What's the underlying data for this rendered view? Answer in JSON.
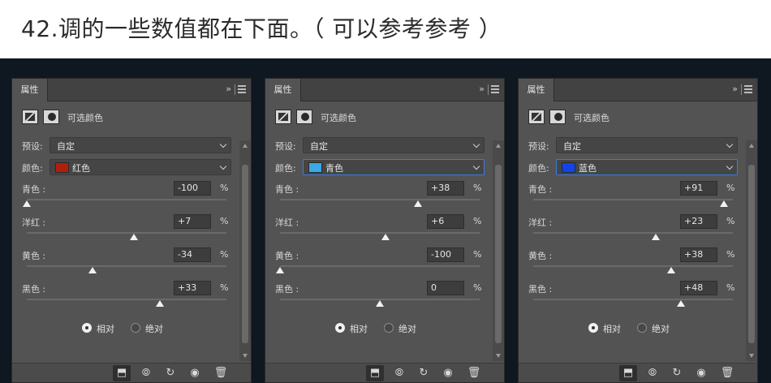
{
  "heading": "42.调的一些数值都在下面。（ 可以参考参考 ）",
  "common": {
    "tab": "属性",
    "collapse_icon": "»",
    "type_label": "可选颜色",
    "preset_label": "预设:",
    "preset_value": "自定",
    "color_label": "颜色:",
    "percent_symbol": "%",
    "radio_relative": "相对",
    "radio_absolute": "绝对"
  },
  "panels": [
    {
      "color_name": "红色",
      "swatch_color": "#b11e0c",
      "sliders": [
        {
          "label": "青色 :",
          "value": "-100",
          "percent": -100
        },
        {
          "label": "洋红 :",
          "value": "+7",
          "percent": 7
        },
        {
          "label": "黄色 :",
          "value": "-34",
          "percent": -34
        },
        {
          "label": "黑色 :",
          "value": "+33",
          "percent": 33
        }
      ]
    },
    {
      "color_name": "青色",
      "swatch_color": "#3aa9e6",
      "sliders": [
        {
          "label": "青色 :",
          "value": "+38",
          "percent": 38
        },
        {
          "label": "洋红 :",
          "value": "+6",
          "percent": 6
        },
        {
          "label": "黄色 :",
          "value": "-100",
          "percent": -100
        },
        {
          "label": "黑色 :",
          "value": "0",
          "percent": 0
        }
      ]
    },
    {
      "color_name": "蓝色",
      "swatch_color": "#1044ea",
      "sliders": [
        {
          "label": "青色 :",
          "value": "+91",
          "percent": 91
        },
        {
          "label": "洋红 :",
          "value": "+23",
          "percent": 23
        },
        {
          "label": "黄色 :",
          "value": "+38",
          "percent": 38
        },
        {
          "label": "黑色 :",
          "value": "+48",
          "percent": 48
        }
      ]
    }
  ],
  "icons": {
    "clip": "clip-to-layer-icon",
    "view_previous": "view-previous-state-icon",
    "reset": "reset-icon",
    "visibility": "eye-icon",
    "delete": "trash-icon"
  }
}
